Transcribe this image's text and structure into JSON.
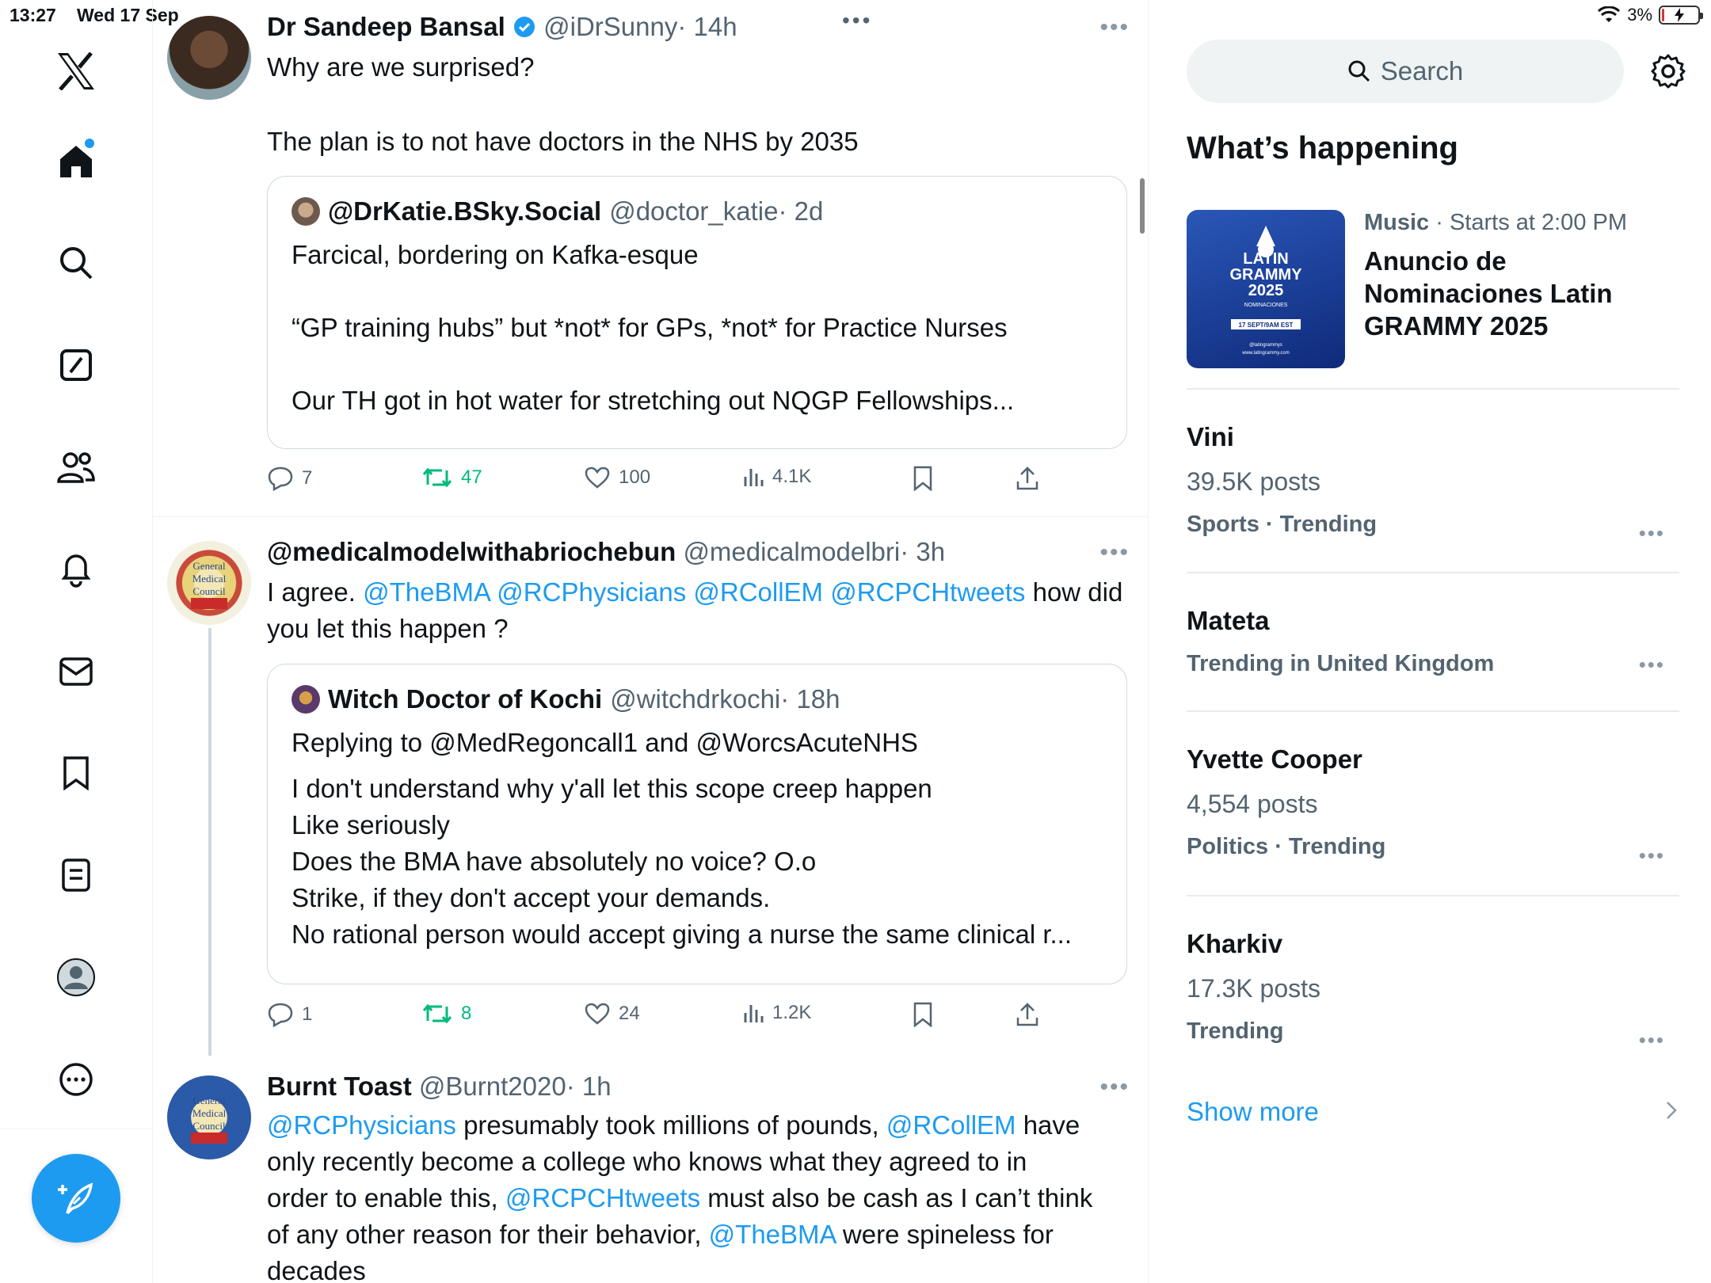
{
  "status_bar": {
    "time": "13:27",
    "date": "Wed 17 Sep",
    "battery": "3%"
  },
  "nav": {
    "items": [
      "home-icon",
      "search-icon",
      "grok-icon",
      "communities-icon",
      "notifications-icon",
      "messages-icon",
      "bookmarks-icon",
      "lists-icon",
      "profile-icon",
      "more-icon"
    ],
    "compose": "compose-post-button",
    "accent": "#1d9bf0"
  },
  "tweets": [
    {
      "name": "Dr Sandeep Bansal",
      "verified": true,
      "handle": "@iDrSunny",
      "time": "· 14h",
      "text1": "Why are we surprised?",
      "text2": "The plan is to not have doctors in the NHS by 2035",
      "quote": {
        "name": "@DrKatie.BSky.Social",
        "handle": "@doctor_katie",
        "time": "· 2d",
        "line1": "Farcical, bordering on Kafka-esque",
        "line2": "“GP training hubs” but *not* for GPs, *not* for Practice Nurses",
        "line3": "Our TH got in hot water for stretching out NQGP Fellowships..."
      },
      "replies": "7",
      "reposts": "47",
      "likes": "100",
      "views": "4.1K"
    },
    {
      "name": "@medicalmodelwithabriochebun",
      "handle": "@medicalmodelbri",
      "time": "· 3h",
      "text_pre": "I agree. ",
      "mentions": "@TheBMA @RCPhysicians @RCollEM @RCPCHtweets",
      "text_post": " how did",
      "text_line2": "you let this happen ?",
      "quote": {
        "name": "Witch Doctor of Kochi",
        "handle": "@witchdrkochi",
        "time": "· 18h",
        "replying": "Replying to @MedRegoncall1 and @WorcsAcuteNHS",
        "line1": "I don't understand why y'all let this scope creep happen",
        "line2": "Like seriously",
        "line3": "Does the BMA have absolutely no voice? O.o",
        "line4": "Strike, if they don't accept your demands.",
        "line5": "No rational person would accept giving a nurse the same clinical r..."
      },
      "replies": "1",
      "reposts": "8",
      "likes": "24",
      "views": "1.2K"
    },
    {
      "name": "Burnt Toast",
      "handle": "@Burnt2020",
      "time": "· 1h",
      "m1": "@RCPhysicians",
      "t1": " presumably took millions of pounds, ",
      "m2": "@RCollEM",
      "t2": " have",
      "t3": "only recently become a college who knows what they agreed to in",
      "t4": "order to enable this, ",
      "m3": "@RCPCHtweets",
      "t5": " must also be cash as I can’t think",
      "t6": "of any other reason for their behavior, ",
      "m4": "@TheBMA",
      "t7": " were spineless for",
      "t8": "decades"
    }
  ],
  "right": {
    "search_placeholder": "Search",
    "section_title": "What’s happening",
    "event": {
      "category": "Music",
      "meta": " · Starts at 2:00 PM",
      "title": "Anuncio de Nominaciones Latin GRAMMY 2025",
      "image_text1": "LATIN",
      "image_text2": "GRAMMY",
      "image_text3": "2025",
      "image_text4": "NOMINACIONES",
      "image_text5": "17 SEPT/9AM EST",
      "image_text6": "@latingrammys",
      "image_text7": "www.latingrammy.com"
    },
    "trends": [
      {
        "name": "Vini",
        "posts": "39.5K posts",
        "category": "Sports · Trending"
      },
      {
        "name": "Mateta",
        "posts": "",
        "category": "Trending in United Kingdom"
      },
      {
        "name": "Yvette Cooper",
        "posts": "4,554 posts",
        "category": "Politics · Trending"
      },
      {
        "name": "Kharkiv",
        "posts": "17.3K posts",
        "category": "Trending"
      }
    ],
    "show_more": "Show more"
  }
}
